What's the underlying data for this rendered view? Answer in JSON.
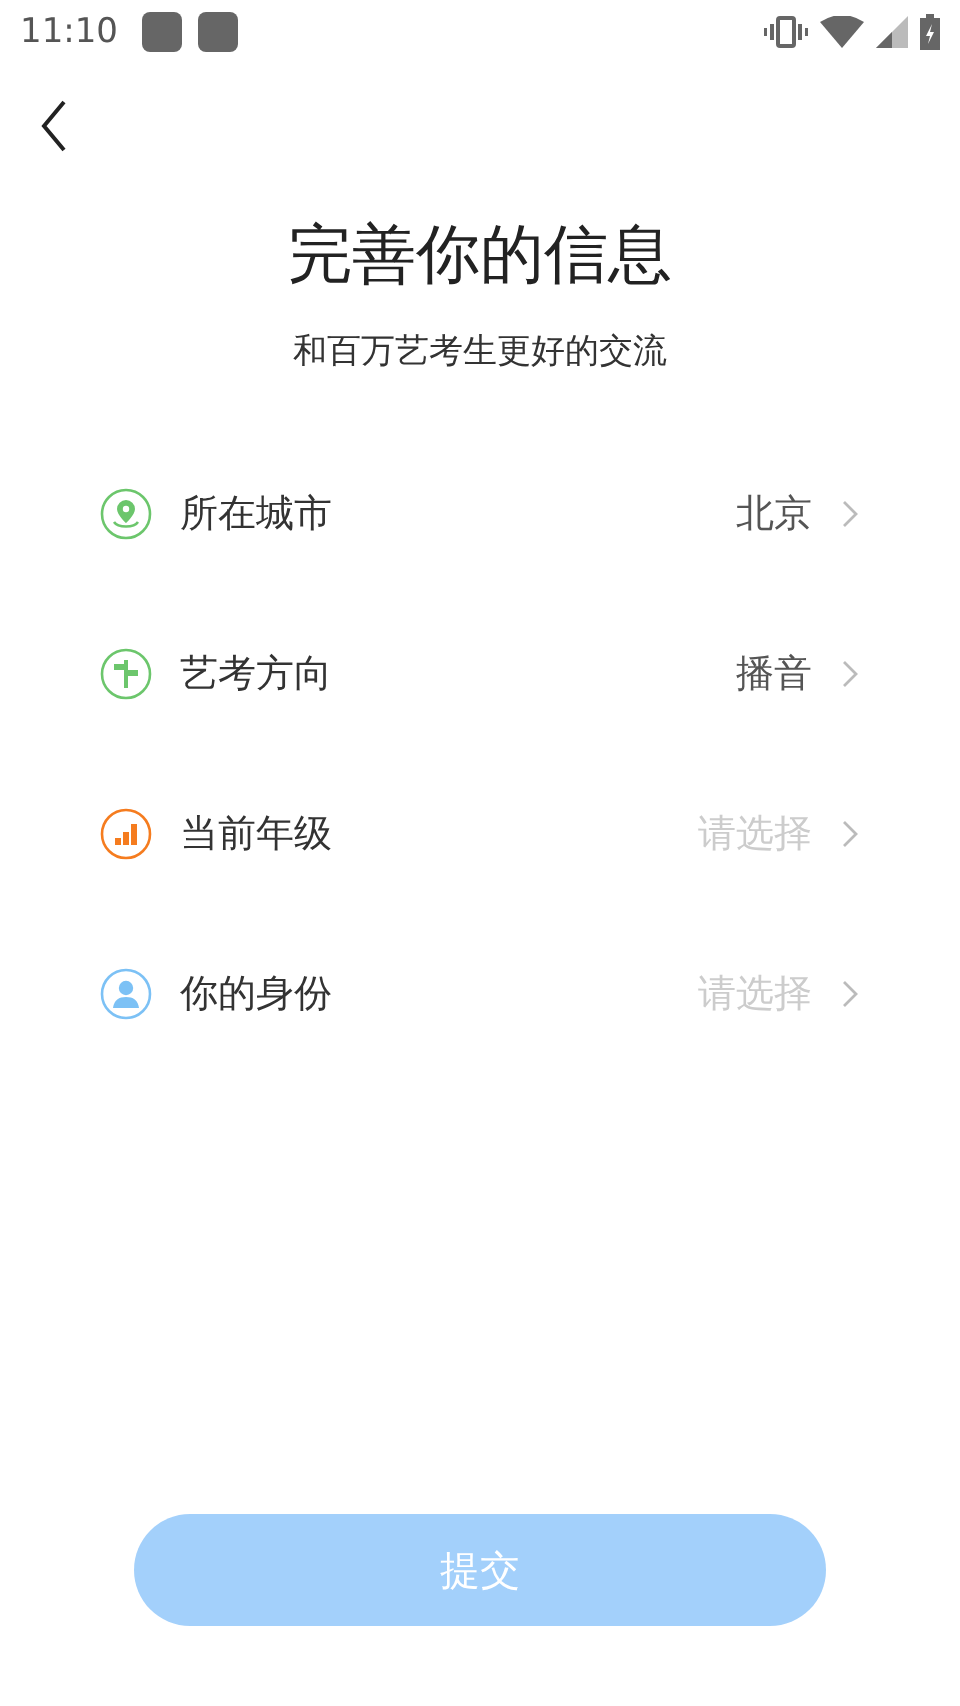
{
  "status_bar": {
    "time": "11:10"
  },
  "title": "完善你的信息",
  "subtitle": "和百万艺考生更好的交流",
  "fields": [
    {
      "kind": "location",
      "color": "#6cc66c",
      "label": "所在城市",
      "value": "北京"
    },
    {
      "kind": "signpost",
      "color": "#6cc66c",
      "label": "艺考方向",
      "value": "播音"
    },
    {
      "kind": "bars",
      "color": "#f57c1f",
      "label": "当前年级",
      "placeholder": "请选择"
    },
    {
      "kind": "person",
      "color": "#7cc1f5",
      "label": "你的身份",
      "placeholder": "请选择"
    }
  ],
  "submit_button": {
    "label": "提交",
    "disabled": true
  }
}
